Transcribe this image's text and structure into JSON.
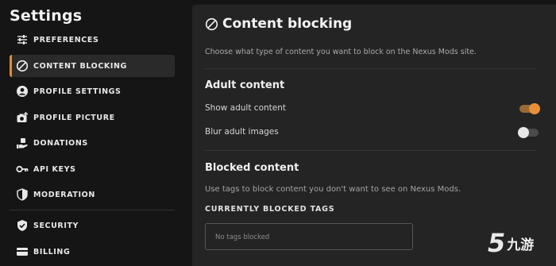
{
  "sidebar": {
    "title": "Settings",
    "items": [
      {
        "label": "PREFERENCES",
        "icon": "sliders-icon",
        "active": false
      },
      {
        "label": "CONTENT BLOCKING",
        "icon": "block-icon",
        "active": true
      },
      {
        "label": "PROFILE SETTINGS",
        "icon": "user-icon",
        "active": false
      },
      {
        "label": "PROFILE PICTURE",
        "icon": "camera-plus-icon",
        "active": false
      },
      {
        "label": "DONATIONS",
        "icon": "donation-hand-icon",
        "active": false
      },
      {
        "label": "API KEYS",
        "icon": "key-icon",
        "active": false
      },
      {
        "label": "MODERATION",
        "icon": "shield-half-icon",
        "active": false
      },
      {
        "label": "SECURITY",
        "icon": "shield-check-icon",
        "active": false
      },
      {
        "label": "BILLING",
        "icon": "card-icon",
        "active": false
      }
    ]
  },
  "main": {
    "title": "Content blocking",
    "title_icon": "block-icon",
    "description": "Choose what type of content you want to block on the Nexus Mods site.",
    "adult_section": {
      "title": "Adult content",
      "toggles": [
        {
          "label": "Show adult content",
          "on": true
        },
        {
          "label": "Blur adult images",
          "on": false
        }
      ]
    },
    "blocked_section": {
      "title": "Blocked content",
      "helper": "Use tags to block content you don't want to see on Nexus Mods.",
      "tags_label": "CURRENTLY BLOCKED TAGS",
      "tags_placeholder": "No tags blocked"
    }
  },
  "watermark": {
    "mark": "5",
    "text": "九游"
  },
  "colors": {
    "accent": "#e88f3a",
    "panel": "#242424",
    "background": "#151515"
  }
}
